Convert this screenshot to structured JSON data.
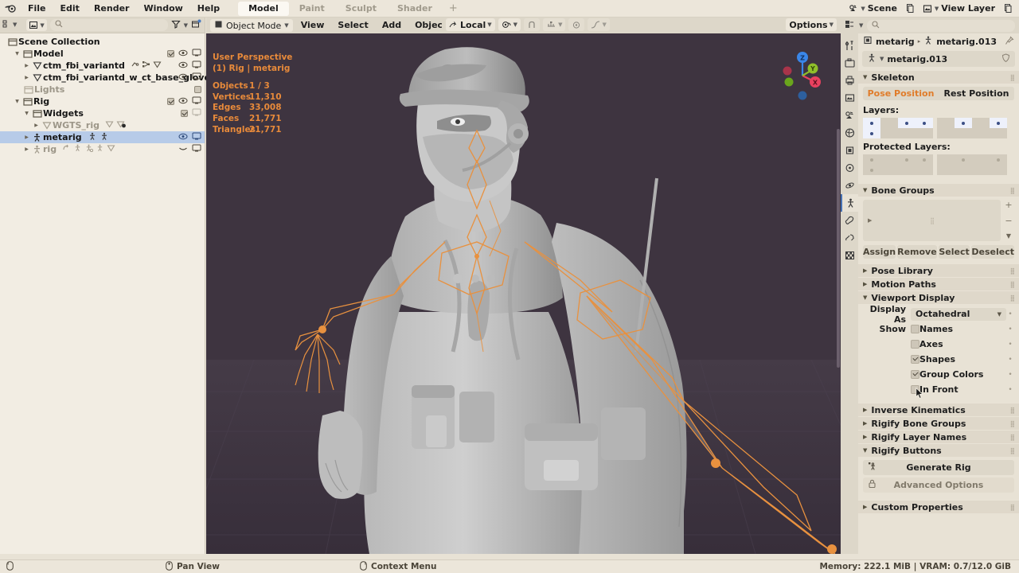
{
  "topbar": {
    "logo_icon": "blender-logo-icon",
    "menus": [
      "File",
      "Edit",
      "Render",
      "Window",
      "Help"
    ],
    "workspace_tabs": [
      {
        "label": "Model",
        "active": true
      },
      {
        "label": "Paint",
        "active": false
      },
      {
        "label": "Sculpt",
        "active": false
      },
      {
        "label": "Shader",
        "active": false
      }
    ],
    "add_workspace_label": "+",
    "scene_label": "Scene",
    "scene_icon": "scene-icon",
    "view_layer_label": "View Layer",
    "view_layer_icon": "view-layer-icon",
    "new_scene_icon": "new-copy-icon",
    "new_view_layer_icon": "new-copy-icon"
  },
  "outliner": {
    "display_mode_icon": "outliner-display-mode-icon",
    "filter_id_icon": "id-type-filter-icon",
    "search_placeholder": "",
    "search_icon": "search-icon",
    "filter_icon": "filter-funnel-icon",
    "new_collection_icon": "new-collection-icon",
    "rows": [
      {
        "indent": 0,
        "tri": "",
        "icon": "collection-icon",
        "name": "Scene Collection",
        "dim": false,
        "selected": false,
        "checkbox": null,
        "eye": false,
        "screen": false,
        "extra": []
      },
      {
        "indent": 1,
        "tri": "down",
        "icon": "collection-icon",
        "name": "Model",
        "dim": false,
        "selected": false,
        "checkbox": true,
        "eye": true,
        "screen": true,
        "extra": []
      },
      {
        "indent": 2,
        "tri": "right",
        "icon": "mesh-data-icon",
        "name": "ctm_fbi_variantd",
        "dim": false,
        "selected": false,
        "checkbox": null,
        "eye": true,
        "screen": true,
        "extra": [
          "modifier-icon",
          "armature-modifier-icon",
          "mesh-triangle-icon"
        ]
      },
      {
        "indent": 2,
        "tri": "right",
        "icon": "mesh-data-icon",
        "name": "ctm_fbi_variantd_w_ct_base_glove",
        "dim": false,
        "selected": false,
        "checkbox": null,
        "eye": true,
        "screen": true,
        "extra": []
      },
      {
        "indent": 2,
        "tri": "",
        "icon": "collection-icon",
        "name": "Lights",
        "dim": true,
        "selected": false,
        "checkbox": false,
        "eye": false,
        "screen": false,
        "extra": []
      },
      {
        "indent": 1,
        "tri": "down",
        "icon": "collection-icon",
        "name": "Rig",
        "dim": false,
        "selected": false,
        "checkbox": true,
        "eye": true,
        "screen": true,
        "extra": []
      },
      {
        "indent": 2,
        "tri": "down",
        "icon": "collection-icon",
        "name": "Widgets",
        "dim": false,
        "selected": false,
        "checkbox": true,
        "eye": false,
        "screen": "off",
        "extra": []
      },
      {
        "indent": 3,
        "tri": "right",
        "icon": "mesh-data-icon",
        "name": "WGTS_rig",
        "dim": true,
        "selected": false,
        "checkbox": null,
        "eye": false,
        "screen": false,
        "extra": [
          "mesh-triangle-icon",
          "hidden-mesh-icon"
        ]
      },
      {
        "indent": 2,
        "tri": "right",
        "icon": "armature-icon",
        "name": "metarig",
        "dim": false,
        "selected": true,
        "checkbox": null,
        "eye": true,
        "screen": true,
        "extra": [
          "armature-data-icon",
          "pose-icon"
        ]
      },
      {
        "indent": 2,
        "tri": "right",
        "icon": "armature-icon",
        "name": "rig",
        "dim": true,
        "selected": false,
        "checkbox": null,
        "eye": "closed",
        "screen": true,
        "extra": [
          "constraint-icon",
          "armature-data-icon",
          "child-of-icon",
          "pose-icon",
          "mesh-triangle-icon"
        ]
      }
    ]
  },
  "viewport": {
    "mode_label": "Object Mode",
    "mode_icon": "object-mode-icon",
    "menus": [
      "View",
      "Select",
      "Add",
      "Object"
    ],
    "gizmo_icon": "gizmo-icon",
    "overlay_icon": "overlays-icon",
    "xray_icon": "xray-icon",
    "shading_icons": [
      "wireframe-shading-icon",
      "solid-shading-icon",
      "material-preview-icon",
      "rendered-shading-icon"
    ],
    "active_shading": "solid-shading-icon",
    "transform_orientation": "Local",
    "transform_orientation_icon": "orientation-icon",
    "pivot_icon": "pivot-point-icon",
    "snap_icon": "snap-magnet-icon",
    "snap_target_icon": "snap-increment-icon",
    "proportional_icon": "proportional-editing-icon",
    "proportional_falloff_icon": "falloff-curve-icon",
    "options_label": "Options",
    "stats": {
      "perspective": "User Perspective",
      "collection_object": "(1) Rig | metarig",
      "rows": [
        {
          "key": "Objects",
          "value": "1 / 3"
        },
        {
          "key": "Vertices",
          "value": "11,310"
        },
        {
          "key": "Edges",
          "value": "33,008"
        },
        {
          "key": "Faces",
          "value": "21,771"
        },
        {
          "key": "Triangles",
          "value": "21,771"
        }
      ]
    },
    "axis_gizmo": {
      "z_label": "Z",
      "y_label": "Y",
      "x_label": "X",
      "z_color": "#3a86e8",
      "y_color": "#8fbf2a",
      "x_color": "#e8415f"
    },
    "background_color": "#3e3440",
    "bone_color": "#e89a4a"
  },
  "properties": {
    "editor_type_icon": "properties-editor-icon",
    "search_icon": "search-icon",
    "search_placeholder": "",
    "tabs": [
      {
        "icon": "tool-icon",
        "active": false
      },
      {
        "icon": "render-icon",
        "active": false
      },
      {
        "icon": "output-printer-icon",
        "active": false
      },
      {
        "icon": "view-layer-icon",
        "active": false
      },
      {
        "icon": "scene-icon",
        "active": false
      },
      {
        "icon": "world-icon",
        "active": false
      },
      {
        "icon": "object-properties-icon",
        "active": false
      },
      {
        "icon": "modifier-physics-icon",
        "active": false
      },
      {
        "icon": "physics-icon",
        "active": false
      },
      {
        "icon": "armature-data-icon",
        "active": true
      },
      {
        "icon": "bone-icon",
        "active": false
      },
      {
        "icon": "bone-constraint-icon",
        "active": false
      },
      {
        "icon": "texture-checker-icon",
        "active": false
      }
    ],
    "breadcrumb": {
      "object_icon": "object-icon",
      "object_name": "metarig",
      "separator": "▸",
      "data_icon": "armature-data-icon",
      "data_name": "metarig.013",
      "pin_icon": "pin-icon"
    },
    "id_block": {
      "icon": "armature-data-icon",
      "name": "metarig.013",
      "shield_icon": "fake-user-shield-icon"
    },
    "panels": {
      "skeleton": {
        "title": "Skeleton",
        "open": true,
        "pose_position_label": "Pose Position",
        "rest_position_label": "Rest Position",
        "active_position": "Pose Position",
        "layers_label": "Layers:",
        "protected_layers_label": "Protected Layers:",
        "layers_left_top": [
          true,
          false,
          true,
          true,
          true
        ],
        "layers_right_top": [
          false,
          true,
          false,
          true
        ],
        "layers_left_bottom": [
          true,
          false,
          false,
          false,
          false
        ],
        "layers_right_bottom": [
          false,
          false,
          false,
          false
        ]
      },
      "bone_groups": {
        "title": "Bone Groups",
        "open": true,
        "add_icon": "plus-icon",
        "remove_icon": "minus-icon",
        "specials_icon": "chevron-down-icon",
        "buttons": [
          "Assign",
          "Remove",
          "Select",
          "Deselect"
        ]
      },
      "pose_library": {
        "title": "Pose Library",
        "open": false
      },
      "motion_paths": {
        "title": "Motion Paths",
        "open": false
      },
      "viewport_display": {
        "title": "Viewport Display",
        "open": true,
        "display_as_label": "Display As",
        "display_as_value": "Octahedral",
        "show_label": "Show",
        "options": [
          {
            "label": "Names",
            "checked": false
          },
          {
            "label": "Axes",
            "checked": false
          },
          {
            "label": "Shapes",
            "checked": true
          },
          {
            "label": "Group Colors",
            "checked": true
          },
          {
            "label": "In Front",
            "checked": false
          }
        ]
      },
      "inverse_kinematics": {
        "title": "Inverse Kinematics",
        "open": false
      },
      "rigify_bone_groups": {
        "title": "Rigify Bone Groups",
        "open": false
      },
      "rigify_layer_names": {
        "title": "Rigify Layer Names",
        "open": false
      },
      "rigify_buttons": {
        "title": "Rigify Buttons",
        "open": true,
        "generate_rig_label": "Generate Rig",
        "generate_rig_icon": "armature-generate-icon",
        "advanced_options_label": "Advanced Options",
        "advanced_options_icon": "lock-icon"
      },
      "custom_properties": {
        "title": "Custom Properties",
        "open": false
      }
    }
  },
  "statusbar": {
    "mouse_left_icon": "mouse-left-icon",
    "mouse_middle_icon": "mouse-middle-icon",
    "pan_view_label": "Pan View",
    "mouse_right_icon": "mouse-right-icon",
    "context_menu_label": "Context Menu",
    "memory_info": "Memory: 222.1 MiB | VRAM: 0.7/12.0 GiB"
  }
}
